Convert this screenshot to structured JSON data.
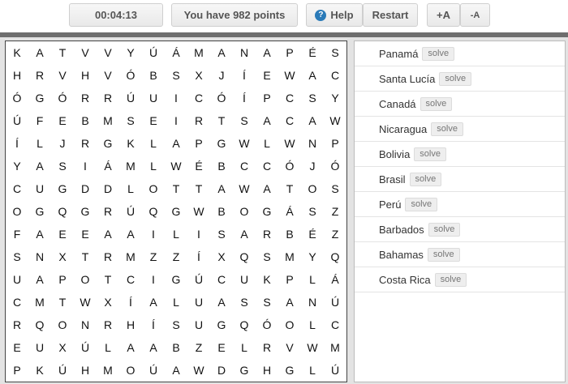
{
  "toolbar": {
    "timer": "00:04:13",
    "points": "You have 982 points",
    "help_label": "Help",
    "help_icon": "?",
    "restart_label": "Restart",
    "font_increase": "+A",
    "font_decrease": "-A"
  },
  "grid": [
    [
      "K",
      "A",
      "T",
      "V",
      "V",
      "Y",
      "Ú",
      "Á",
      "M",
      "A",
      "N",
      "A",
      "P",
      "É",
      "S"
    ],
    [
      "H",
      "R",
      "V",
      "H",
      "V",
      "Ó",
      "B",
      "S",
      "X",
      "J",
      "Í",
      "E",
      "W",
      "A",
      "C"
    ],
    [
      "Ó",
      "G",
      "Ó",
      "R",
      "R",
      "Ú",
      "U",
      "I",
      "C",
      "Ó",
      "Í",
      "P",
      "C",
      "S",
      "Y"
    ],
    [
      "Ú",
      "F",
      "E",
      "B",
      "M",
      "S",
      "E",
      "I",
      "R",
      "T",
      "S",
      "A",
      "C",
      "A",
      "W"
    ],
    [
      "Í",
      "L",
      "J",
      "R",
      "G",
      "K",
      "L",
      "A",
      "P",
      "G",
      "W",
      "L",
      "W",
      "N",
      "P"
    ],
    [
      "Y",
      "A",
      "S",
      "I",
      "Á",
      "M",
      "L",
      "W",
      "É",
      "B",
      "C",
      "C",
      "Ó",
      "J",
      "Ó"
    ],
    [
      "C",
      "U",
      "G",
      "D",
      "D",
      "L",
      "O",
      "T",
      "T",
      "A",
      "W",
      "A",
      "T",
      "O",
      "S"
    ],
    [
      "O",
      "G",
      "Q",
      "G",
      "R",
      "Ú",
      "Q",
      "G",
      "W",
      "B",
      "O",
      "G",
      "Á",
      "S",
      "Z"
    ],
    [
      "F",
      "A",
      "E",
      "E",
      "A",
      "A",
      "I",
      "L",
      "I",
      "S",
      "A",
      "R",
      "B",
      "É",
      "Z"
    ],
    [
      "S",
      "N",
      "X",
      "T",
      "R",
      "M",
      "Z",
      "Z",
      "Í",
      "X",
      "Q",
      "S",
      "M",
      "Y",
      "Q"
    ],
    [
      "U",
      "A",
      "P",
      "O",
      "T",
      "C",
      "I",
      "G",
      "Ú",
      "C",
      "U",
      "K",
      "P",
      "L",
      "Á"
    ],
    [
      "C",
      "M",
      "T",
      "W",
      "X",
      "Í",
      "A",
      "L",
      "U",
      "A",
      "S",
      "S",
      "A",
      "N",
      "Ú"
    ],
    [
      "R",
      "Q",
      "O",
      "N",
      "R",
      "H",
      "Í",
      "S",
      "U",
      "G",
      "Q",
      "Ó",
      "O",
      "L",
      "C"
    ],
    [
      "E",
      "U",
      "X",
      "Ú",
      "L",
      "A",
      "A",
      "B",
      "Z",
      "E",
      "L",
      "R",
      "V",
      "W",
      "M"
    ],
    [
      "P",
      "K",
      "Ú",
      "H",
      "M",
      "O",
      "Ú",
      "A",
      "W",
      "D",
      "G",
      "H",
      "G",
      "L",
      "Ú"
    ]
  ],
  "words": [
    {
      "name": "Panamá",
      "action": "solve"
    },
    {
      "name": "Santa Lucía",
      "action": "solve"
    },
    {
      "name": "Canadá",
      "action": "solve"
    },
    {
      "name": "Nicaragua",
      "action": "solve"
    },
    {
      "name": "Bolivia",
      "action": "solve"
    },
    {
      "name": "Brasil",
      "action": "solve"
    },
    {
      "name": "Perú",
      "action": "solve"
    },
    {
      "name": "Barbados",
      "action": "solve"
    },
    {
      "name": "Bahamas",
      "action": "solve"
    },
    {
      "name": "Costa Rica",
      "action": "solve"
    }
  ]
}
